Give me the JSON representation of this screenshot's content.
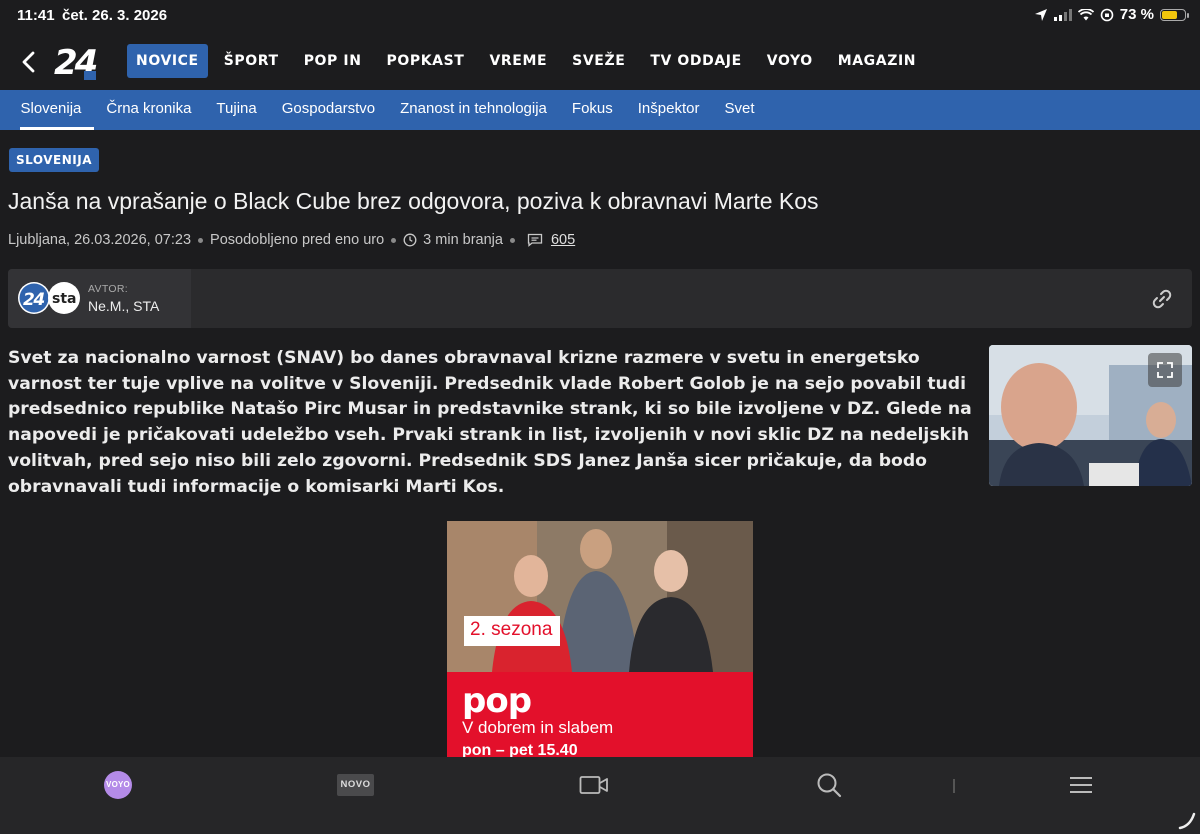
{
  "status_bar": {
    "time": "11:41",
    "date": "čet. 26. 3. 2026",
    "battery_text": "73 %",
    "battery_level": 0.73
  },
  "main_nav": {
    "logo_text": "24",
    "items": [
      {
        "label": "NOVICE",
        "active": true
      },
      {
        "label": "ŠPORT"
      },
      {
        "label": "POP IN"
      },
      {
        "label": "POPKAST"
      },
      {
        "label": "VREME"
      },
      {
        "label": "SVEŽE"
      },
      {
        "label": "TV ODDAJE"
      },
      {
        "label": "VOYO"
      },
      {
        "label": "MAGAZIN"
      }
    ]
  },
  "sub_nav": {
    "items": [
      {
        "label": "Slovenija",
        "active": true
      },
      {
        "label": "Črna kronika"
      },
      {
        "label": "Tujina"
      },
      {
        "label": "Gospodarstvo"
      },
      {
        "label": "Znanost in tehnologija"
      },
      {
        "label": "Fokus"
      },
      {
        "label": "Inšpektor"
      },
      {
        "label": "Svet"
      }
    ]
  },
  "article": {
    "tag": "SLOVENIJA",
    "headline": "Janša na vprašanje o Black Cube brez odgovora, poziva k obravnavi Marte Kos",
    "location_time": "Ljubljana, 26.03.2026, 07:23",
    "updated": "Posodobljeno pred eno uro",
    "read_time": "3 min branja",
    "comments": "605",
    "author_label": "AVTOR:",
    "author_name": "Ne.M., STA",
    "author_logo_24": "24",
    "author_logo_sta": "sta",
    "lead": "Svet za nacionalno varnost (SNAV) bo danes obravnaval krizne razmere v svetu in energetsko varnost ter tuje vplive na volitve v Sloveniji. Predsednik vlade Robert Golob je na sejo povabil tudi predsednico republike Natašo Pirc Musar in predstavnike strank, ki so bile izvoljene v DZ. Glede na napovedi je pričakovati udeležbo vseh. Prvaki strank in list, izvoljenih v novi sklic DZ na nedeljskih volitvah, pred sejo niso bili zelo zgovorni. Predsednik SDS Janez Janša sicer pričakuje, da bodo obravnavali tudi informacije o komisarki Marti Kos."
  },
  "ad": {
    "season": "2. sezona",
    "brand": "pop",
    "title": "V dobrem in slabem",
    "schedule": "pon – pet 15.40"
  },
  "bottom_bar": {
    "voyo": "VOYO",
    "novo": "NOVO"
  },
  "colors": {
    "accent": "#2f63ad",
    "ad_red": "#e3102b",
    "background": "#1c1c1e"
  }
}
